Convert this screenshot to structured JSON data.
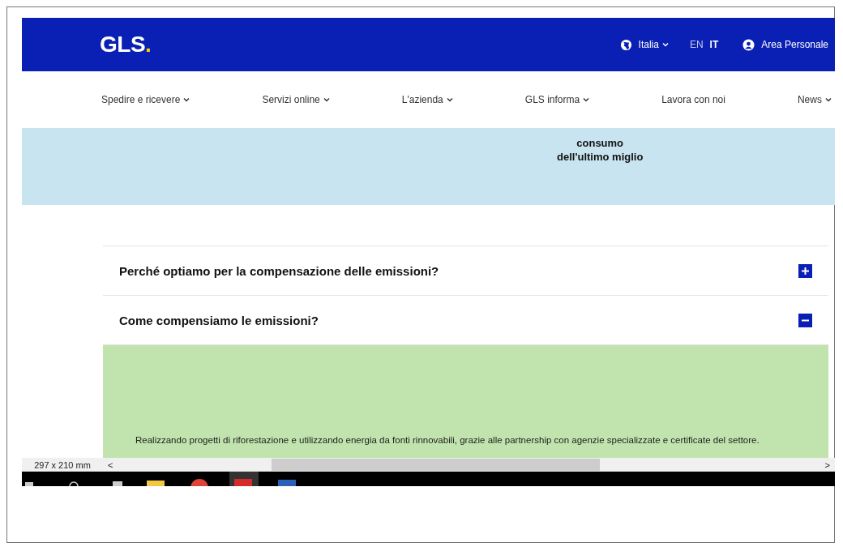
{
  "header": {
    "logo": "GLS",
    "logo_dot": ".",
    "country": "Italia",
    "languages": [
      {
        "label": "EN",
        "selected": false
      },
      {
        "label": "IT",
        "selected": true
      }
    ],
    "account": "Area Personale"
  },
  "nav": [
    {
      "label": "Spedire e ricevere",
      "dropdown": true
    },
    {
      "label": "Servizi online",
      "dropdown": true
    },
    {
      "label": "L'azienda",
      "dropdown": true
    },
    {
      "label": "GLS informa",
      "dropdown": true
    },
    {
      "label": "Lavora con noi",
      "dropdown": false
    },
    {
      "label": "News",
      "dropdown": true
    }
  ],
  "banner": {
    "columns": [
      [
        "consumo",
        "dell'ultimo miglio"
      ]
    ]
  },
  "accordion": [
    {
      "title": "Perché optiamo per la compensazione delle emissioni?",
      "expanded": false
    },
    {
      "title": "Come compensiamo le emissioni?",
      "expanded": true,
      "body": "Realizzando progetti di riforestazione e utilizzando energia da fonti rinnovabili, grazie alle partnership con agenzie specializzate e certificate del settore."
    }
  ],
  "status_bar": {
    "page_size": "297 x 210 mm",
    "left_arrow": "<",
    "right_arrow": ">"
  }
}
